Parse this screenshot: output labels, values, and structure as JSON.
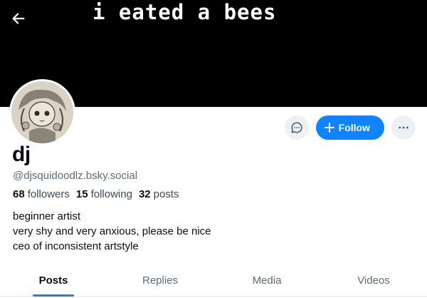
{
  "banner": {
    "text": "i eated a bees",
    "back_icon": "arrow-left-icon"
  },
  "profile": {
    "display_name": "dj",
    "handle": "@djsquidoodlz.bsky.social",
    "stats": {
      "followers_count": "68",
      "followers_label": "followers",
      "following_count": "15",
      "following_label": "following",
      "posts_count": "32",
      "posts_label": "posts"
    },
    "bio": [
      "beginner artist",
      "very shy and very anxious, please be nice",
      "ceo of inconsistent artstyle"
    ]
  },
  "actions": {
    "message_icon": "chat-bubble-icon",
    "follow_label": "Follow",
    "follow_icon": "plus-icon",
    "more_icon": "ellipsis-icon"
  },
  "tabs": [
    {
      "label": "Posts",
      "active": true
    },
    {
      "label": "Replies",
      "active": false
    },
    {
      "label": "Media",
      "active": false
    },
    {
      "label": "Videos",
      "active": false
    }
  ],
  "colors": {
    "accent": "#1083fe",
    "banner": "#000000",
    "muted": "#5b6b7c"
  }
}
